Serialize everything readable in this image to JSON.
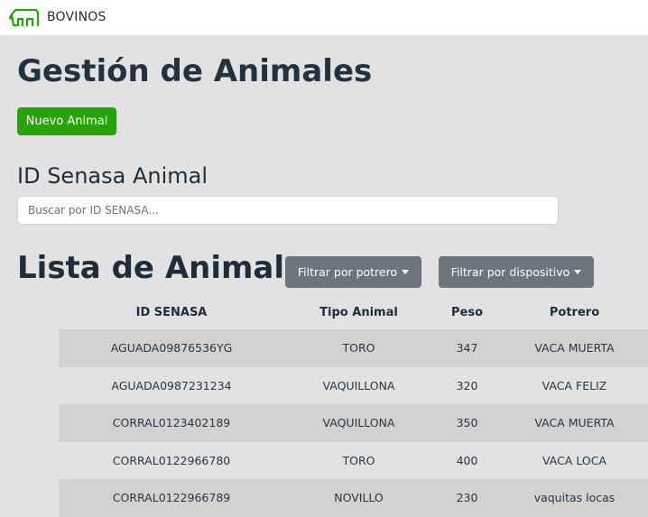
{
  "navbar": {
    "brand": "BOVINOS",
    "brand_icon": "cow-icon",
    "brand_color": "#28a40a"
  },
  "main": {
    "title": "Gestión de Animales",
    "new_button_label": "Nuevo Animal",
    "new_button_color": "#28a40a",
    "search": {
      "label": "ID Senasa Animal",
      "placeholder": "Buscar por ID SENASA...",
      "value": ""
    },
    "list": {
      "title": "Lista de Animales",
      "filter_potrero_label": "Filtrar por potrero",
      "filter_dispositivo_label": "Filtrar por dispositivo",
      "filter_button_color": "#6c757d",
      "columns": [
        "ID SENASA",
        "Tipo Animal",
        "Peso",
        "Potrero"
      ],
      "rows": [
        [
          "AGUADA09876536YG",
          "TORO",
          "347",
          "VACA MUERTA"
        ],
        [
          "AGUADA0987231234",
          "VAQUILLONA",
          "320",
          "VACA FELIZ"
        ],
        [
          "CORRAL0123402189",
          "VAQUILLONA",
          "350",
          "VACA MUERTA"
        ],
        [
          "CORRAL0122966780",
          "TORO",
          "400",
          "VACA LOCA"
        ],
        [
          "CORRAL0122966789",
          "NOVILLO",
          "230",
          "vaquitas locas"
        ]
      ]
    }
  }
}
